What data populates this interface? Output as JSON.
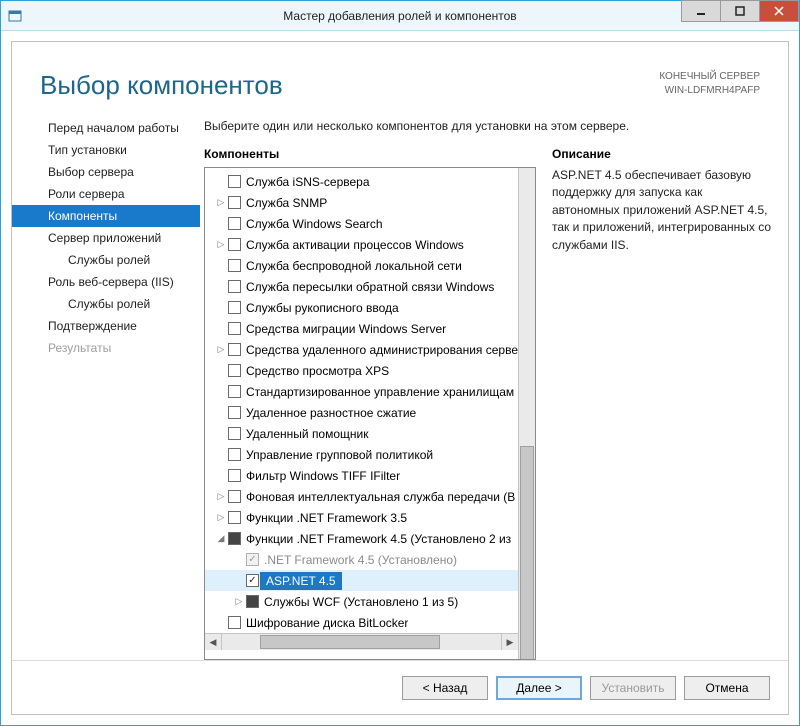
{
  "window": {
    "title": "Мастер добавления ролей и компонентов"
  },
  "header": {
    "page_title": "Выбор компонентов",
    "dest_label": "КОНЕЧНЫЙ СЕРВЕР",
    "dest_value": "WIN-LDFMRH4PAFP"
  },
  "nav": {
    "items": [
      {
        "label": "Перед началом работы"
      },
      {
        "label": "Тип установки"
      },
      {
        "label": "Выбор сервера"
      },
      {
        "label": "Роли сервера"
      },
      {
        "label": "Компоненты",
        "selected": true
      },
      {
        "label": "Сервер приложений"
      },
      {
        "label": "Службы ролей",
        "sub": true
      },
      {
        "label": "Роль веб-сервера (IIS)"
      },
      {
        "label": "Службы ролей",
        "sub": true
      },
      {
        "label": "Подтверждение"
      },
      {
        "label": "Результаты",
        "disabled": true
      }
    ]
  },
  "main": {
    "instruction": "Выберите один или несколько компонентов для установки на этом сервере.",
    "components_label": "Компоненты",
    "description_label": "Описание",
    "description_text": "ASP.NET 4.5 обеспечивает базовую поддержку для запуска как автономных приложений ASP.NET 4.5, так и приложений, интегрированных со службами IIS."
  },
  "tree": {
    "items": [
      {
        "depth": 0,
        "label": "Служба iSNS-сервера"
      },
      {
        "depth": 0,
        "label": "Служба SNMP",
        "expander": "▷"
      },
      {
        "depth": 0,
        "label": "Служба Windows Search"
      },
      {
        "depth": 0,
        "label": "Служба активации процессов Windows",
        "expander": "▷"
      },
      {
        "depth": 0,
        "label": "Служба беспроводной локальной сети"
      },
      {
        "depth": 0,
        "label": "Служба пересылки обратной связи Windows"
      },
      {
        "depth": 0,
        "label": "Службы рукописного ввода"
      },
      {
        "depth": 0,
        "label": "Средства миграции Windows Server"
      },
      {
        "depth": 0,
        "label": "Средства удаленного администрирования серве",
        "expander": "▷"
      },
      {
        "depth": 0,
        "label": "Средство просмотра XPS"
      },
      {
        "depth": 0,
        "label": "Стандартизированное управление хранилищам"
      },
      {
        "depth": 0,
        "label": "Удаленное разностное сжатие"
      },
      {
        "depth": 0,
        "label": "Удаленный помощник"
      },
      {
        "depth": 0,
        "label": "Управление групповой политикой"
      },
      {
        "depth": 0,
        "label": "Фильтр Windows TIFF IFilter"
      },
      {
        "depth": 0,
        "label": "Фоновая интеллектуальная служба передачи (B",
        "expander": "▷"
      },
      {
        "depth": 0,
        "label": "Функции .NET Framework 3.5",
        "expander": "▷"
      },
      {
        "depth": 0,
        "label": "Функции .NET Framework 4.5 (Установлено 2 из",
        "expander": "◢",
        "cb_state": "partial"
      },
      {
        "depth": 1,
        "label": ".NET Framework 4.5 (Установлено)",
        "cb_state": "checked",
        "disabled": true,
        "grey": true
      },
      {
        "depth": 1,
        "label": "ASP.NET 4.5",
        "cb_state": "checked",
        "selected": true
      },
      {
        "depth": 1,
        "label": "Службы WCF (Установлено 1 из 5)",
        "expander": "▷",
        "cb_state": "partial"
      },
      {
        "depth": 0,
        "label": "Шифрование диска BitLocker"
      }
    ]
  },
  "footer": {
    "back": "< Назад",
    "next": "Далее >",
    "install": "Установить",
    "cancel": "Отмена"
  }
}
